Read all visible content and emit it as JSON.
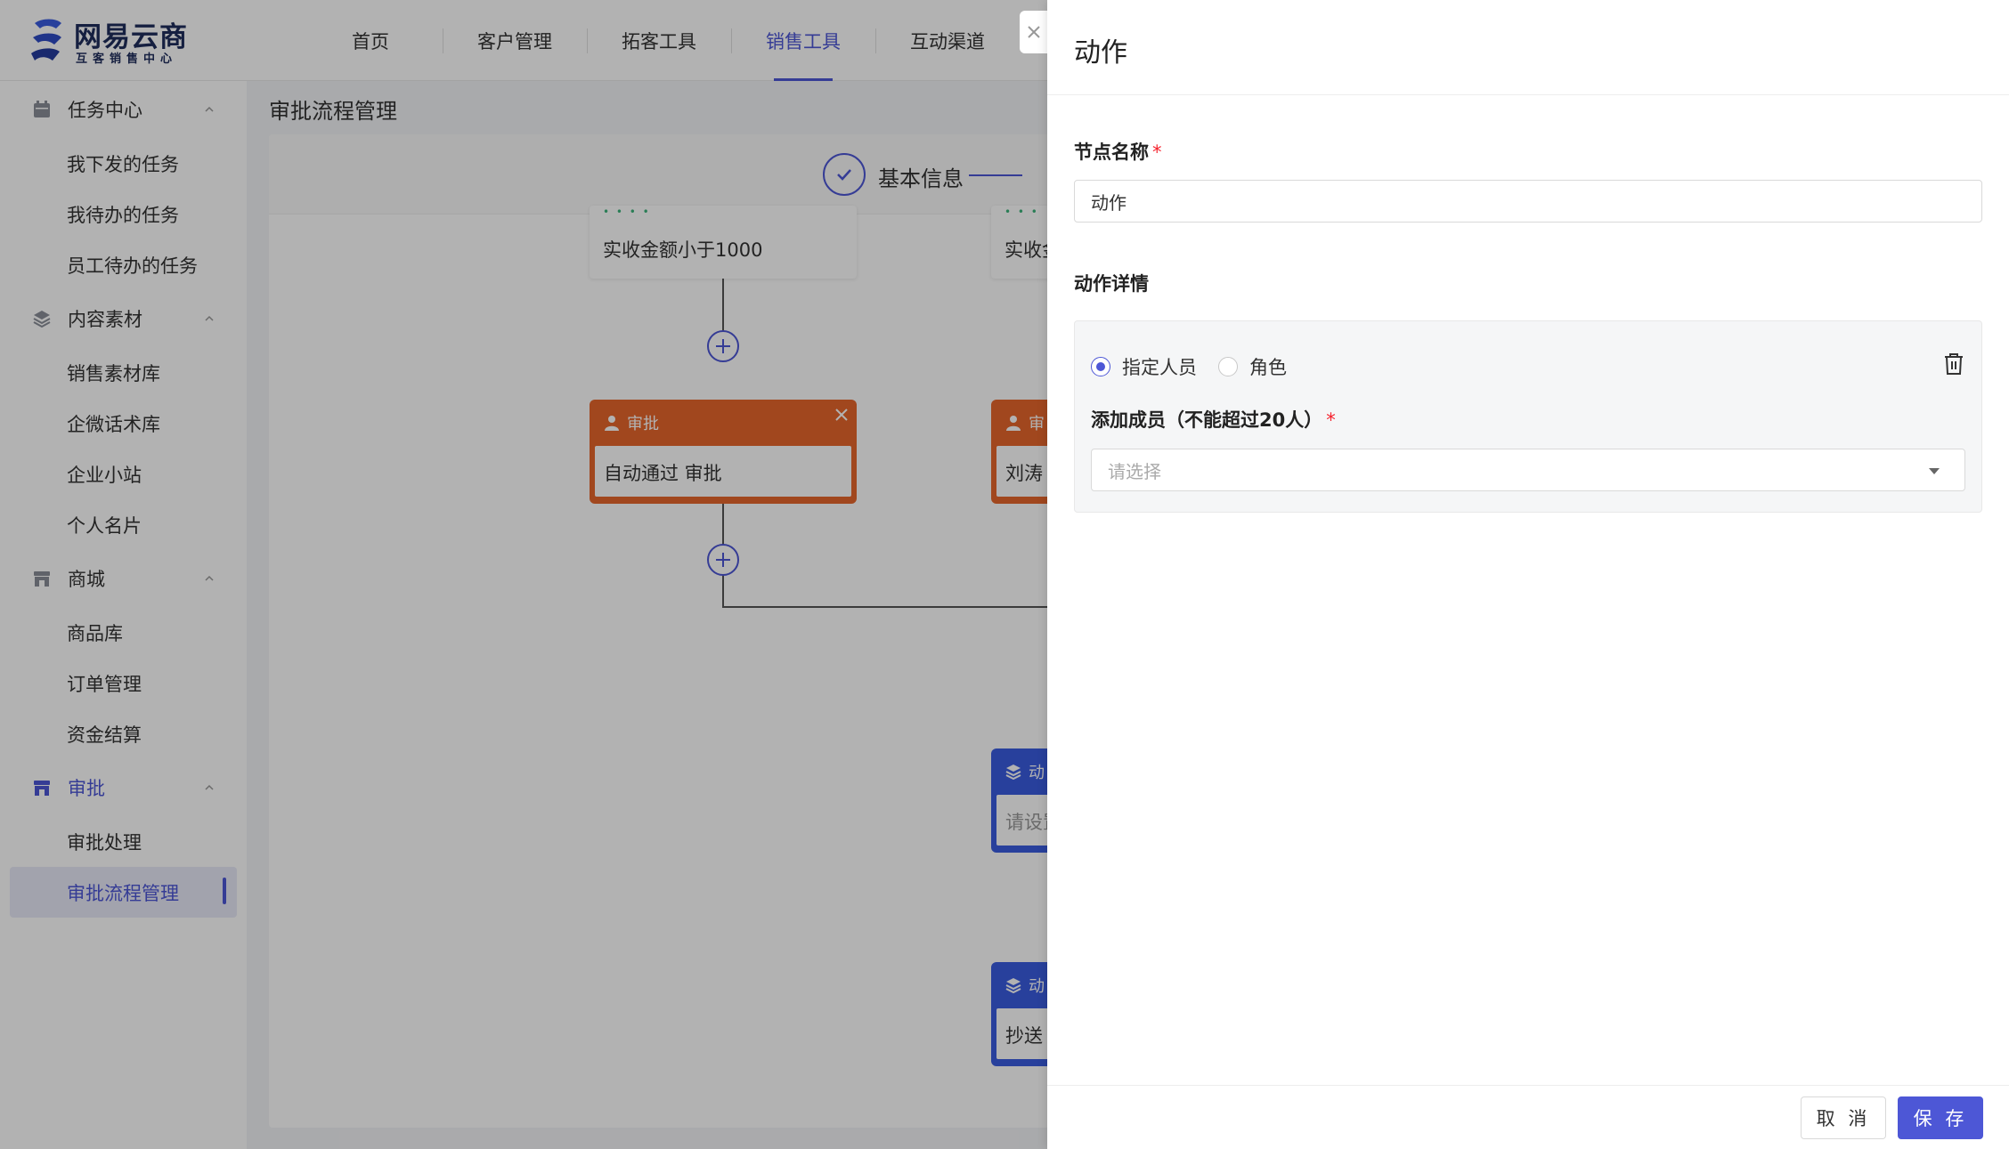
{
  "brand": {
    "title": "网易云商",
    "subtitle": "互客销售中心"
  },
  "nav": {
    "tabs": [
      {
        "label": "首页"
      },
      {
        "label": "客户管理"
      },
      {
        "label": "拓客工具"
      },
      {
        "label": "销售工具",
        "active": true
      },
      {
        "label": "互动渠道"
      }
    ]
  },
  "sidebar": {
    "groups": [
      {
        "label": "任务中心",
        "icon": "calendar-icon",
        "items": [
          "我下发的任务",
          "我待办的任务",
          "员工待办的任务"
        ]
      },
      {
        "label": "内容素材",
        "icon": "layers-icon",
        "items": [
          "销售素材库",
          "企微话术库",
          "企业小站",
          "个人名片"
        ]
      },
      {
        "label": "商城",
        "icon": "store-icon",
        "items": [
          "商品库",
          "订单管理",
          "资金结算"
        ]
      },
      {
        "label": "审批",
        "icon": "store-icon",
        "active": true,
        "items": [
          "审批处理",
          "审批流程管理"
        ],
        "active_item": "审批流程管理"
      }
    ]
  },
  "page": {
    "title": "审批流程管理",
    "step_label": "基本信息"
  },
  "flow": {
    "conditions": [
      "实收金额小于1000",
      "实收金"
    ],
    "approval_nodes": [
      {
        "head": "审批",
        "body": "自动通过 审批"
      },
      {
        "head": "审",
        "body": "刘涛"
      }
    ],
    "action_nodes": [
      {
        "head": "动",
        "body": "请设置"
      },
      {
        "head": "动",
        "body": "抄送"
      }
    ]
  },
  "drawer": {
    "title": "动作",
    "node_name_label": "节点名称",
    "node_name_value": "动作",
    "action_detail_label": "动作详情",
    "radio_options": [
      {
        "label": "指定人员",
        "checked": true
      },
      {
        "label": "角色",
        "checked": false
      }
    ],
    "members_label": "添加成员（不能超过20人）",
    "members_placeholder": "请选择",
    "cancel_label": "取 消",
    "save_label": "保 存"
  },
  "colors": {
    "accent": "#4d57d6",
    "approval_node": "#e7662b",
    "action_node": "#3a5ce0",
    "required": "#f5222d"
  }
}
